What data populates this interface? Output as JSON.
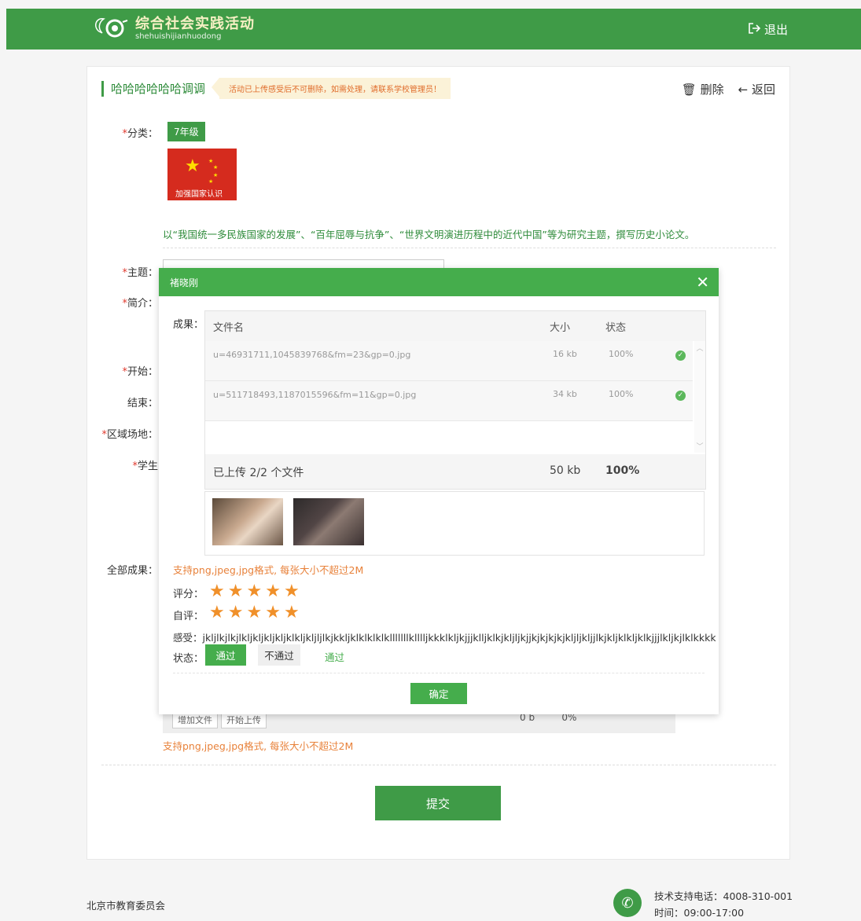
{
  "header": {
    "title": "综合社会实践活动",
    "subtitle": "shehuishijianhuodong",
    "logout_label": "退出"
  },
  "page": {
    "activity_title": "哈哈哈哈哈哈调调",
    "notice": "活动已上传感受后不可删除，如需处理，请联系学校管理员！",
    "delete_label": "删除",
    "back_label": "返回"
  },
  "form": {
    "category_label": "分类：",
    "category_value": "7年级",
    "flag_caption": "加强国家认识",
    "description": "以“我国统一多民族国家的发展”、“百年屈辱与抗争”、“世界文明演进历程中的近代中国”等为研究主题，撰写历史小论文。",
    "theme_label": "主题：",
    "intro_label": "简介：",
    "start_label": "开始：",
    "end_label": "结束：",
    "venue_label": "区域场地：",
    "student_label": "学生",
    "all_results_label": "全部成果：",
    "under_add": "增加文件",
    "under_upload": "开始上传",
    "under_size": "0 b",
    "under_pct": "0%",
    "under_tip": "支持png,jpeg,jpg格式, 每张大小不超过2M",
    "submit_label": "提交"
  },
  "modal": {
    "title": "褚晓刚",
    "result_label": "成果：",
    "columns": [
      "文件名",
      "大小",
      "状态"
    ],
    "files": [
      {
        "name": "u=46931711,1045839768&fm=23&gp=0.jpg",
        "size": "16 kb",
        "status": "100%"
      },
      {
        "name": "u=511718493,1187015596&fm=11&gp=0.jpg",
        "size": "34 kb",
        "status": "100%"
      }
    ],
    "footer_text": "已上传 2/2 个文件",
    "footer_size": "50 kb",
    "footer_pct": "100%",
    "tip": "支持png,jpeg,jpg格式, 每张大小不超过2M",
    "score_label": "评分：",
    "score": 5,
    "self_label": "自评：",
    "self_score": 5,
    "feel_label": "感受：",
    "feel_text": "jkljlkjlkjlkljkljkljkljklkljkljljlkjkkljklklklklklllllllklllljkkklkljkjjjklljklkjkljljkjjkjkjkjkjkljljkljjlkjkljklkljklkjjjlkljkjlklkkkkkkkkkkl",
    "status_label": "状态：",
    "pass_label": "通过",
    "fail_label": "不通过",
    "status_value": "通过",
    "confirm_label": "确定"
  },
  "footer": {
    "org": "北京市教育委员会",
    "phone": "技术支持电话：4008-310-001",
    "hours": "时间：09:00-17:00"
  },
  "colors": {
    "brand": "#3f9b47",
    "accent_orange": "#f0902a",
    "star": "#f0902a"
  }
}
